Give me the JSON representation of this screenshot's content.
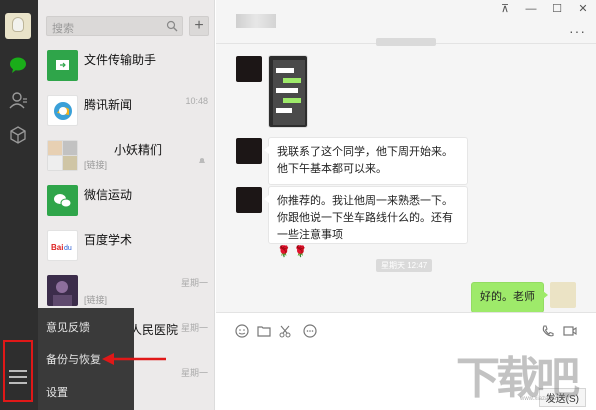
{
  "search": {
    "placeholder": "搜索",
    "add": "+"
  },
  "chats": [
    {
      "name": "文件传输助手",
      "time": "",
      "sub": "",
      "icon": "folder-icon"
    },
    {
      "name": "腾讯新闻",
      "time": "10:48",
      "sub": "",
      "icon": "tencent-news-icon"
    },
    {
      "name": "小妖精们",
      "time": "",
      "sub": "[链接]",
      "icon": "group-avatar"
    },
    {
      "name": "微信运动",
      "time": "",
      "sub": "",
      "icon": "wechat-sport-icon"
    },
    {
      "name": "百度学术",
      "time": "",
      "sub": "",
      "icon": "baidu-scholar-logo"
    },
    {
      "name": "",
      "time": "星期一",
      "sub": "[链接]",
      "icon": "contact-avatar"
    },
    {
      "name": "人民医院",
      "time": "星期一",
      "sub": "",
      "icon": "hospital-avatar"
    },
    {
      "name": "",
      "time": "星期一",
      "sub": "",
      "icon": "contact-avatar"
    }
  ],
  "popup_menu": [
    "意见反馈",
    "备份与恢复",
    "设置"
  ],
  "window": {
    "pin": "⊼",
    "minimize": "—",
    "maximize": "☐",
    "close": "✕",
    "more": "···"
  },
  "messages": [
    {
      "text": "我联系了这个同学，他下周开始来。他下午基本都可以来。"
    },
    {
      "text": "你推荐的。我让他周一来熟悉一下。你跟他说一下坐车路线什么的。还有一些注意事项"
    },
    {
      "emoji": "🌹 🌹"
    }
  ],
  "timestamp_weekday": "星期天 12:47",
  "my_message": "好的。老师",
  "send_label": "发送(S)",
  "watermark": {
    "main": "下载吧",
    "url": "www.xiazaiba.com"
  }
}
